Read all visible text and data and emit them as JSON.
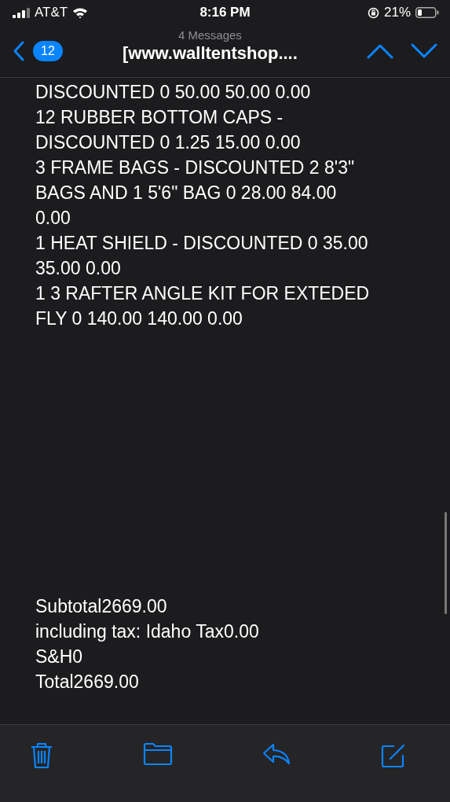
{
  "status_bar": {
    "carrier": "AT&T",
    "time": "8:16 PM",
    "battery": "21%"
  },
  "nav": {
    "unread_count": "12",
    "message_count": "4 Messages",
    "subject": "[www.walltentshop...."
  },
  "body_lines": [
    "DISCOUNTED 0 50.00 50.00 0.00",
    "12 RUBBER BOTTOM CAPS -",
    "DISCOUNTED 0 1.25 15.00 0.00",
    "3 FRAME BAGS - DISCOUNTED 2 8'3\"",
    "BAGS AND 1 5'6\" BAG 0 28.00 84.00",
    "0.00",
    "1 HEAT SHIELD - DISCOUNTED 0 35.00",
    "35.00 0.00",
    "1 3 RAFTER ANGLE KIT FOR EXTEDED",
    "FLY 0 140.00 140.00 0.00"
  ],
  "totals": [
    "Subtotal2669.00",
    "including tax: Idaho Tax0.00",
    "S&H0",
    "Total2669.00"
  ]
}
